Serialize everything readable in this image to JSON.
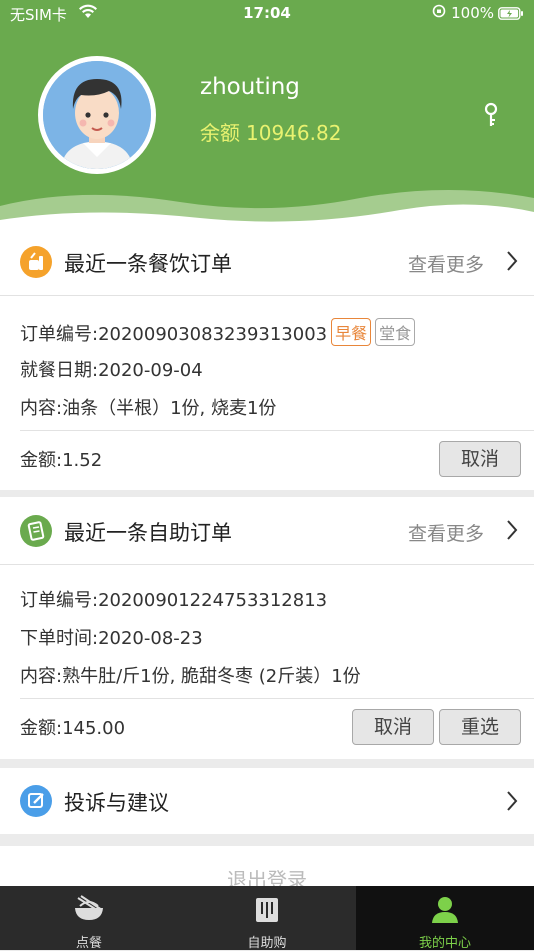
{
  "status_bar": {
    "carrier": "无SIM卡",
    "time": "17:04",
    "battery_pct": "100%"
  },
  "profile": {
    "username": "zhouting",
    "balance_label": "余额",
    "balance_value": "10946.82"
  },
  "meal_order": {
    "title": "最近一条餐饮订单",
    "more_label": "查看更多",
    "order_no": "订单编号:20200903083239313003",
    "tag_meal": "早餐",
    "tag_type": "堂食",
    "date": "就餐日期:2020-09-04",
    "content": "内容:油条（半根）1份, 烧麦1份",
    "amount": "金额:1.52",
    "cancel_label": "取消"
  },
  "self_order": {
    "title": "最近一条自助订单",
    "more_label": "查看更多",
    "order_no": "订单编号:20200901224753312813",
    "date": "下单时间:2020-08-23",
    "content": "内容:熟牛肚/斤1份, 脆甜冬枣 (2斤装）1份",
    "amount": "金额:145.00",
    "cancel_label": "取消",
    "reselect_label": "重选"
  },
  "feedback": {
    "title": "投诉与建议"
  },
  "logout_label": "退出登录",
  "tabs": [
    {
      "label": "点餐",
      "icon": "bowl-icon"
    },
    {
      "label": "自助购",
      "icon": "shopping-bag-icon"
    },
    {
      "label": "我的中心",
      "icon": "user-icon"
    }
  ],
  "colors": {
    "header_green": "#6aaa4e",
    "balance_yellow": "#e9f270",
    "tab_active": "#7dd14a",
    "tag_orange": "#e8863a"
  }
}
